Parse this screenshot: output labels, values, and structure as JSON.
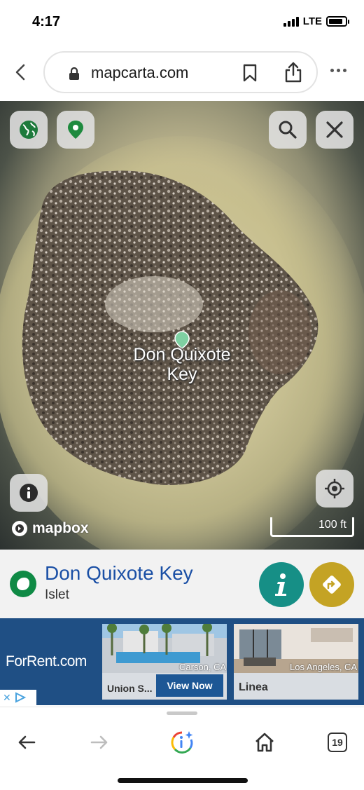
{
  "status_bar": {
    "time": "4:17",
    "network": "LTE",
    "battery_level": 0.85
  },
  "browser": {
    "url": "mapcarta.com"
  },
  "map": {
    "label_line1": "Don Quixote",
    "label_line2": "Key",
    "attribution": "mapbox",
    "scale": "100 ft",
    "icons": {
      "globe": "globe-icon",
      "pin": "location-pin-icon",
      "search": "search-icon",
      "close": "close-icon",
      "info": "info-icon",
      "locate": "locate-icon"
    }
  },
  "place": {
    "name": "Don Quixote Key",
    "type": "Islet"
  },
  "ad": {
    "brand": "ForRent.com",
    "cards": [
      {
        "location": "Carson, CA",
        "title": "Union S...",
        "cta": "View Now"
      },
      {
        "location": "Los Angeles, CA",
        "title": "Linea"
      }
    ]
  },
  "toolbar": {
    "tab_count": "19"
  },
  "colors": {
    "accent_blue": "#1a4fa5",
    "info_teal": "#168f86",
    "directions_gold": "#c4a324",
    "ad_blue": "#1f4f84"
  }
}
